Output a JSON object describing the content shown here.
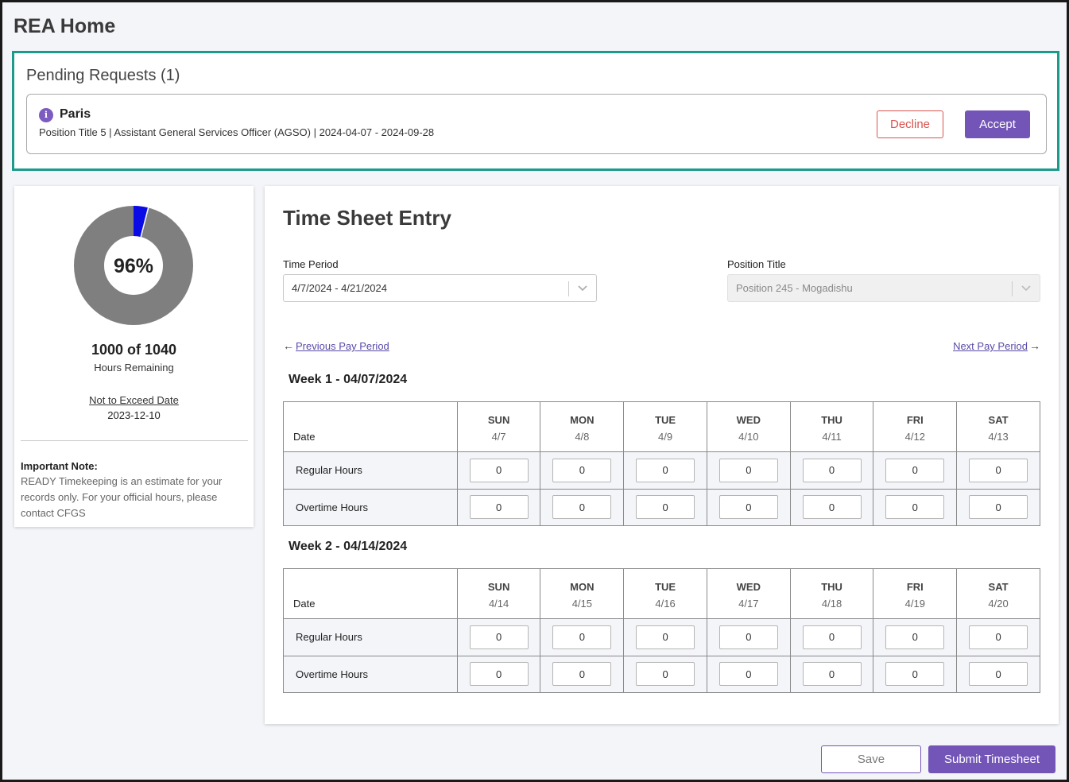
{
  "page": {
    "title": "REA Home"
  },
  "pending": {
    "title": "Pending Requests (1)",
    "request": {
      "name": "Paris",
      "details": "Position Title 5 | Assistant General Services Officer (AGSO) | 2024-04-07 - 2024-09-28",
      "decline_label": "Decline",
      "accept_label": "Accept"
    }
  },
  "summary": {
    "percent_label": "96%",
    "percent_value": 0.96,
    "hours": "1000 of 1040",
    "hours_label": "Hours Remaining",
    "nte_label": "Not to Exceed Date",
    "nte_date": "2023-12-10",
    "note_title": "Important Note:",
    "note_body": "READY Timekeeping is an estimate for your records only. For your official hours, please contact CFGS",
    "colors": {
      "remaining": "#7f7f7f",
      "used": "#0a0ae6"
    }
  },
  "timesheet": {
    "title": "Time Sheet Entry",
    "time_period_label": "Time Period",
    "time_period_value": "4/7/2024 - 4/21/2024",
    "position_label": "Position Title",
    "position_value": "Position 245 - Mogadishu",
    "prev_label": "Previous Pay Period",
    "next_label": "Next Pay Period",
    "date_col_label": "Date",
    "regular_label": "Regular Hours",
    "overtime_label": "Overtime Hours",
    "weeks": [
      {
        "title": "Week 1 - 04/07/2024",
        "days": [
          {
            "name": "SUN",
            "date": "4/7"
          },
          {
            "name": "MON",
            "date": "4/8"
          },
          {
            "name": "TUE",
            "date": "4/9"
          },
          {
            "name": "WED",
            "date": "4/10"
          },
          {
            "name": "THU",
            "date": "4/11"
          },
          {
            "name": "FRI",
            "date": "4/12"
          },
          {
            "name": "SAT",
            "date": "4/13"
          }
        ],
        "regular": [
          "0",
          "0",
          "0",
          "0",
          "0",
          "0",
          "0"
        ],
        "overtime": [
          "0",
          "0",
          "0",
          "0",
          "0",
          "0",
          "0"
        ]
      },
      {
        "title": "Week 2 - 04/14/2024",
        "days": [
          {
            "name": "SUN",
            "date": "4/14"
          },
          {
            "name": "MON",
            "date": "4/15"
          },
          {
            "name": "TUE",
            "date": "4/16"
          },
          {
            "name": "WED",
            "date": "4/17"
          },
          {
            "name": "THU",
            "date": "4/18"
          },
          {
            "name": "FRI",
            "date": "4/19"
          },
          {
            "name": "SAT",
            "date": "4/20"
          }
        ],
        "regular": [
          "0",
          "0",
          "0",
          "0",
          "0",
          "0",
          "0"
        ],
        "overtime": [
          "0",
          "0",
          "0",
          "0",
          "0",
          "0",
          "0"
        ]
      }
    ]
  },
  "footer": {
    "save_label": "Save",
    "submit_label": "Submit Timesheet"
  }
}
